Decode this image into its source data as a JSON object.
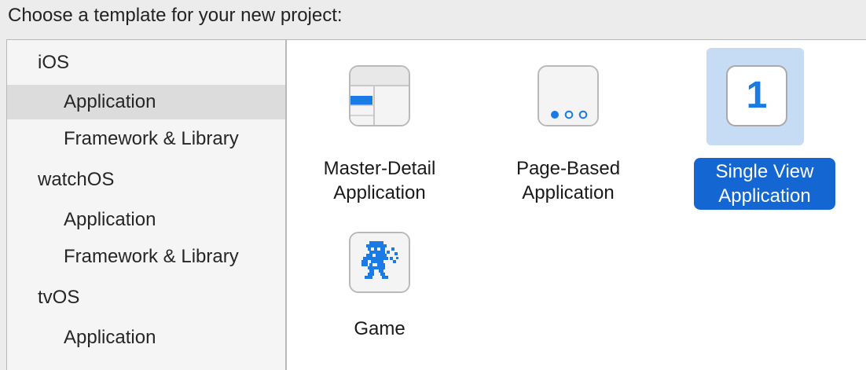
{
  "header": {
    "title": "Choose a template for your new project:"
  },
  "sidebar": {
    "items": [
      {
        "label": "iOS",
        "kind": "platform"
      },
      {
        "label": "Application",
        "kind": "category",
        "selected": true
      },
      {
        "label": "Framework & Library",
        "kind": "category"
      },
      {
        "label": "watchOS",
        "kind": "platform"
      },
      {
        "label": "Application",
        "kind": "category"
      },
      {
        "label": "Framework & Library",
        "kind": "category"
      },
      {
        "label": "tvOS",
        "kind": "platform"
      },
      {
        "label": "Application",
        "kind": "category"
      }
    ]
  },
  "templates": [
    {
      "line1": "Master-Detail",
      "line2": "Application",
      "icon": "master-detail-icon",
      "selected": false
    },
    {
      "line1": "Page-Based",
      "line2": "Application",
      "icon": "page-based-icon",
      "selected": false
    },
    {
      "line1": "Single View",
      "line2": "Application",
      "icon": "single-view-icon",
      "glyph": "1",
      "selected": true
    },
    {
      "line1": "Game",
      "line2": "",
      "icon": "game-icon",
      "selected": false
    }
  ],
  "colors": {
    "accent": "#1466d3",
    "selection_tint": "#c6dbf4",
    "icon_blue": "#1a7be6"
  }
}
